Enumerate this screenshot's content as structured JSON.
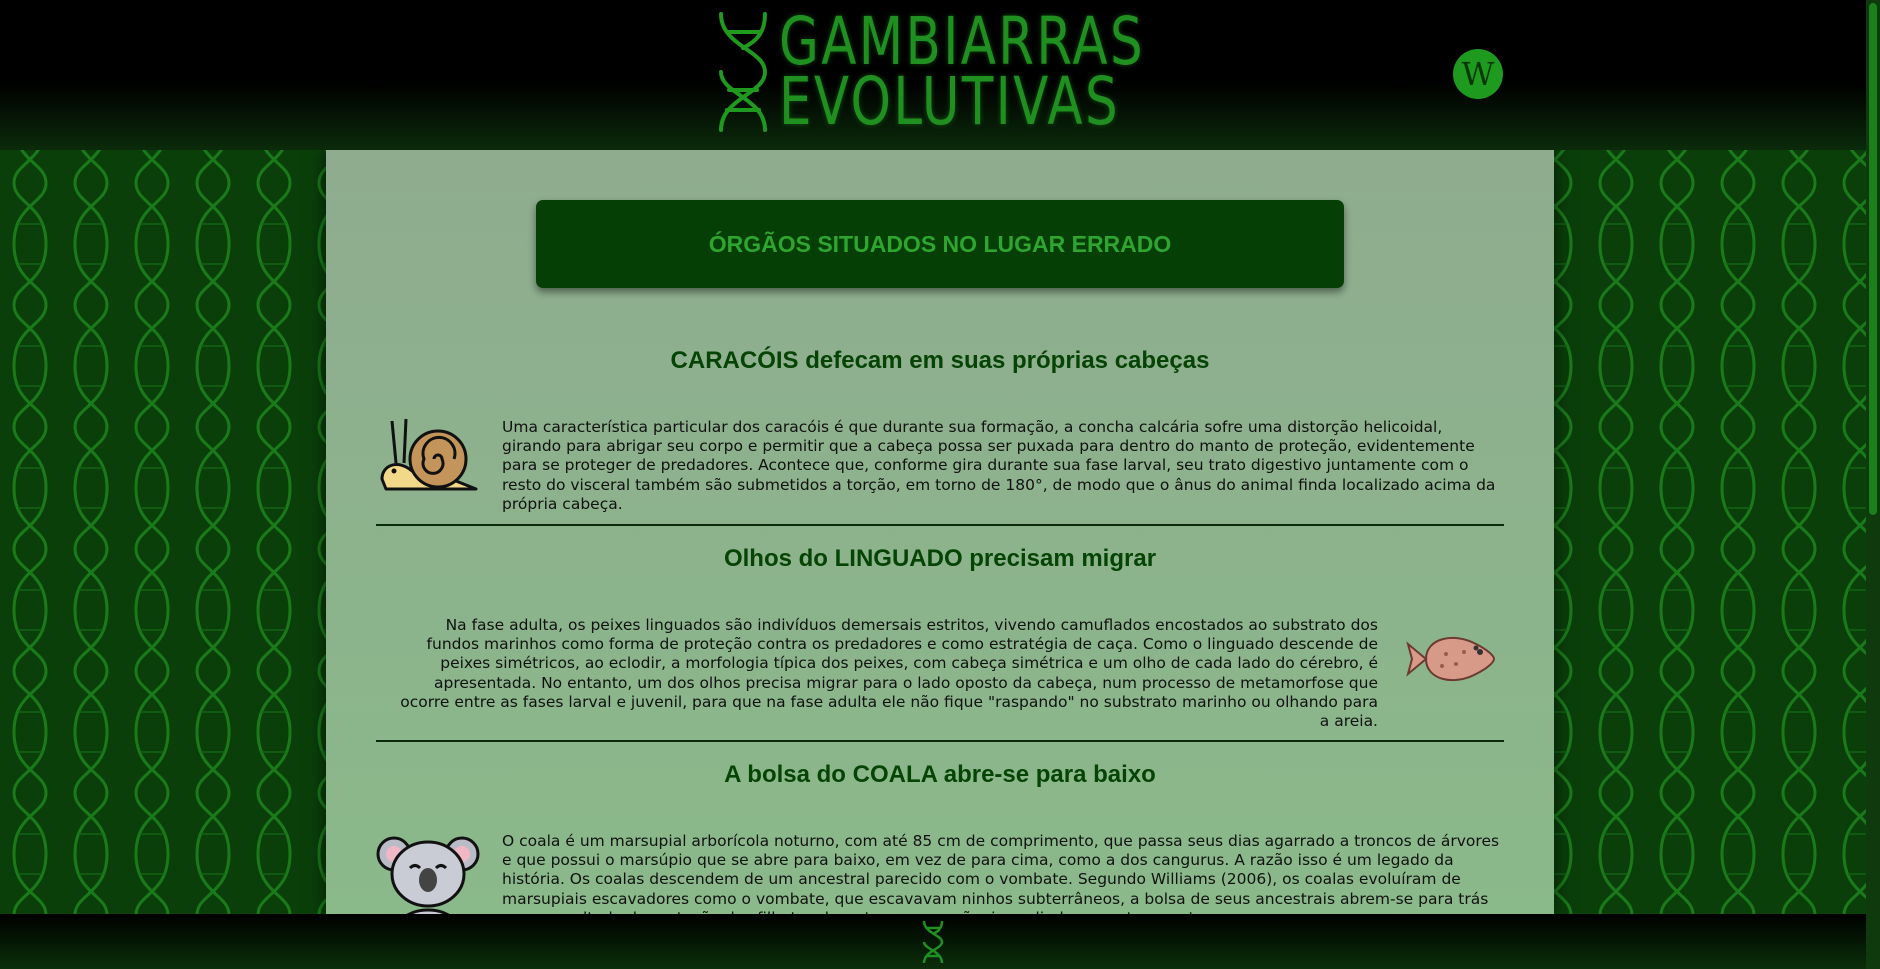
{
  "site": {
    "logo_line1": "GAMBIARRAS",
    "logo_line2": "EVOLUTIVAS",
    "wiki_label": "W"
  },
  "page": {
    "banner_title": "ÓRGÃOS SITUADOS NO LUGAR ERRADO"
  },
  "sections": [
    {
      "title": "CARACÓIS defecam em suas próprias cabeças",
      "icon": "snail-icon",
      "text": "Uma característica particular dos caracóis é que durante sua formação, a concha calcária sofre uma distorção helicoidal, girando para abrigar seu corpo e permitir que a cabeça possa ser puxada para dentro do manto de proteção, evidentemente para se proteger de predadores. Acontece que, conforme gira durante sua fase larval, seu trato digestivo juntamente com o resto do visceral também são submetidos a torção, em torno de 180°, de modo que o ânus do animal finda localizado acima da própria cabeça."
    },
    {
      "title": "Olhos do LINGUADO precisam migrar",
      "icon": "flounder-fish-icon",
      "text": "Na fase adulta, os peixes linguados são indivíduos demersais estritos, vivendo camuflados encostados ao substrato dos fundos marinhos como forma de proteção contra os predadores e como estratégia de caça. Como o linguado descende de peixes simétricos, ao eclodir, a morfologia típica dos peixes, com cabeça simétrica e um olho de cada lado do cérebro, é apresentada. No entanto, um dos olhos precisa migrar para o lado oposto da cabeça, num processo de metamorfose que ocorre entre as fases larval e juvenil, para que na fase adulta ele não fique \"raspando\" no substrato marinho ou olhando para a areia."
    },
    {
      "title": "A bolsa do COALA abre-se para baixo",
      "icon": "koala-icon",
      "text": "O coala é um marsupial arborícola noturno, com até 85 cm de comprimento, que passa seus dias agarrado a troncos de árvores e que possui o marsúpio que se abre para baixo, em vez de para cima, como a dos cangurus. A razão isso é um legado da história. Os coalas descendem de um ancestral parecido com o vombate. Segundo Williams (2006), os coalas evoluíram de marsupiais escavadores como o vombate, que escavavam ninhos subterrâneos, a bolsa de seus ancestrais abrem-se para trás como resultado de proteção dos filhotes durante a escavação, impedindo que a terra entrasse."
    }
  ],
  "colors": {
    "accent": "#1f8f1f",
    "banner_bg": "#053f05",
    "content_bg": "#8fac8f",
    "title": "#064406"
  }
}
